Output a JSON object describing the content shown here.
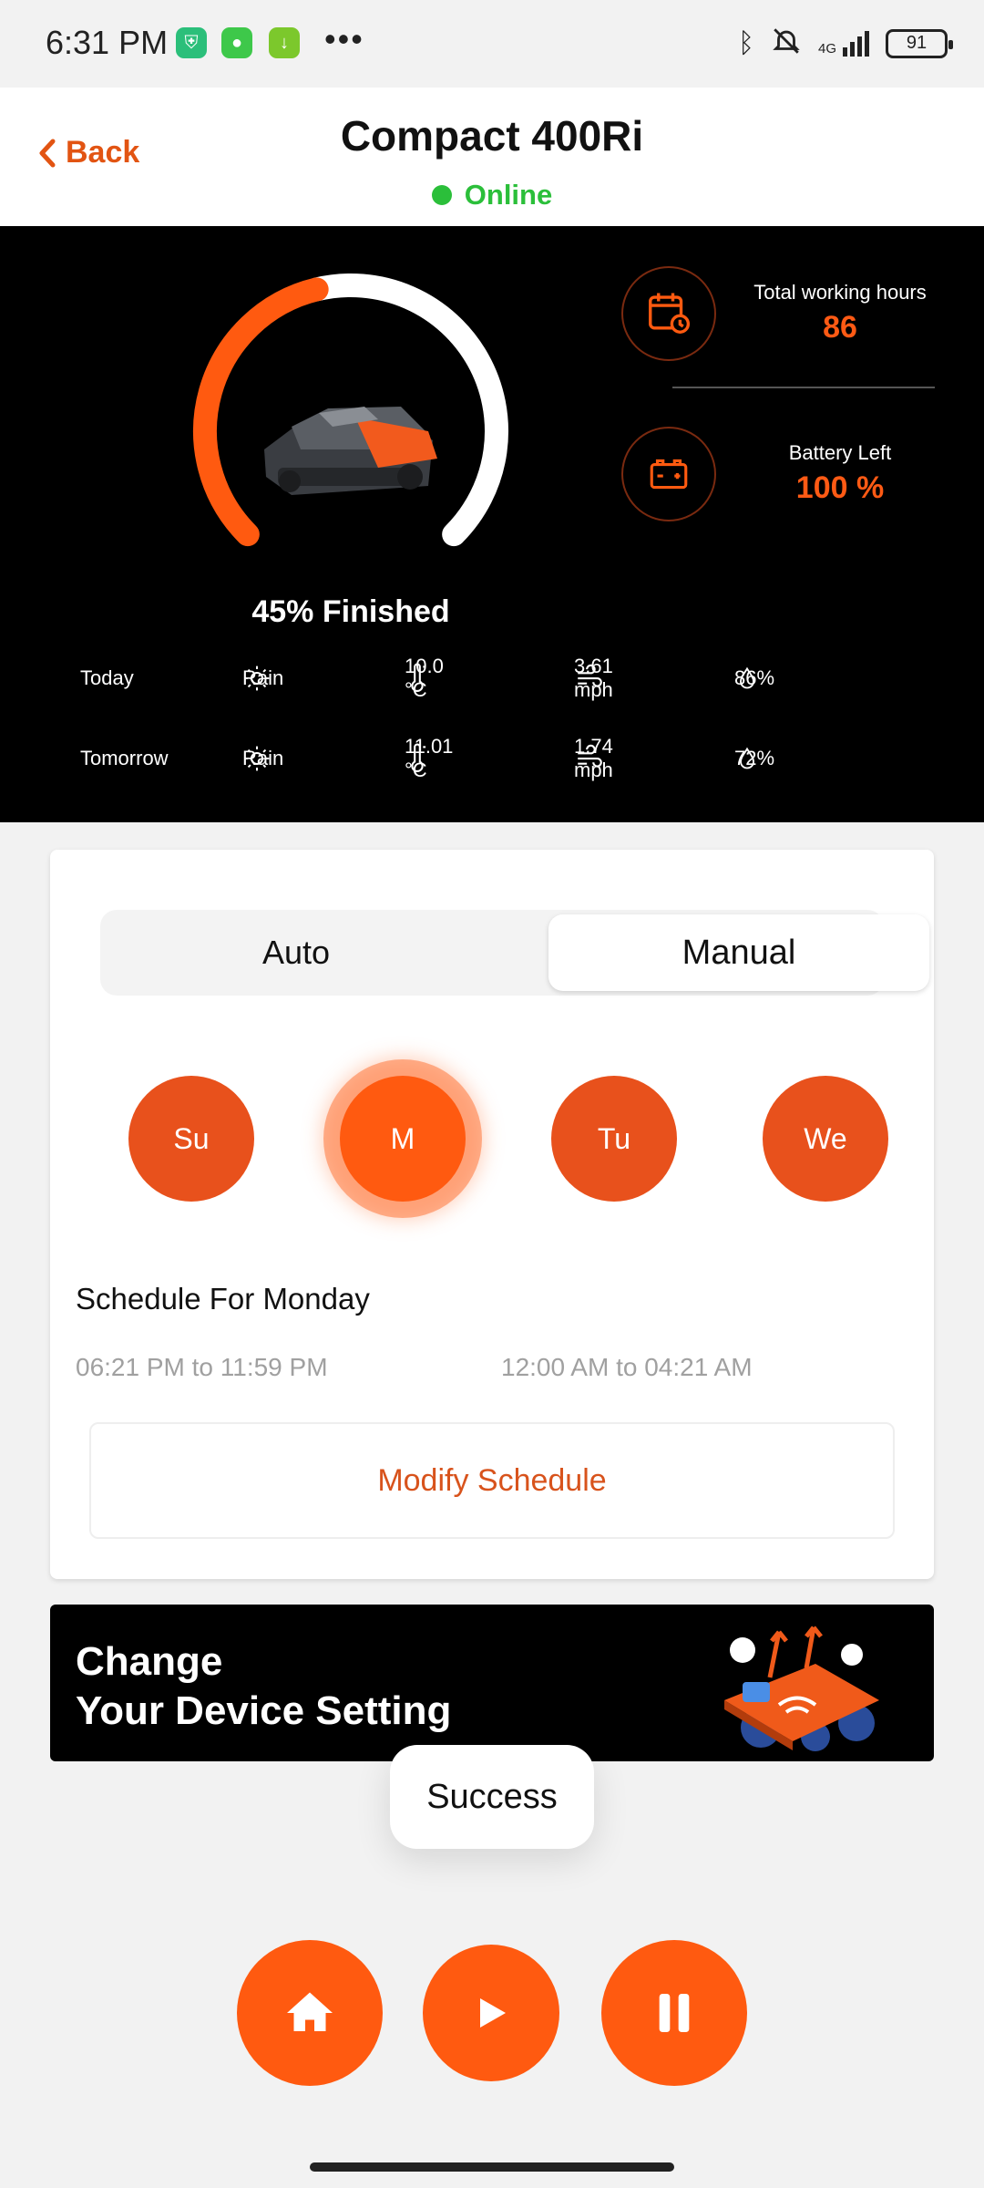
{
  "status_bar": {
    "time": "6:31 PM",
    "network": "4G",
    "battery": "91"
  },
  "header": {
    "back_label": "Back",
    "title": "Compact 400Ri",
    "status": "Online"
  },
  "dashboard": {
    "progress_text": "45% Finished",
    "progress_fraction": 0.45,
    "total_hours_label": "Total working hours",
    "total_hours_value": "86",
    "battery_label": "Battery Left",
    "battery_value": "100 %",
    "weather": [
      {
        "day": "Today",
        "condition": "Rain",
        "temp": "10.0 °C",
        "wind": "3.61 mph",
        "humidity": "86%"
      },
      {
        "day": "Tomorrow",
        "condition": "Rain",
        "temp": "11.01 °C",
        "wind": "1.74 mph",
        "humidity": "72%"
      }
    ]
  },
  "schedule": {
    "modes": [
      "Auto",
      "Manual"
    ],
    "selected_mode": "Manual",
    "days": [
      "Su",
      "M",
      "Tu",
      "We"
    ],
    "selected_day": "M",
    "title": "Schedule For Monday",
    "slots": [
      "06:21 PM to 11:59 PM",
      "12:00 AM to 04:21 AM"
    ],
    "modify_label": "Modify Schedule"
  },
  "banner": {
    "line1": "Change",
    "line2": "Your Device Setting"
  },
  "toast": "Success",
  "colors": {
    "accent": "#ff5a10",
    "online": "#2bbf3a",
    "panel": "#000000"
  }
}
